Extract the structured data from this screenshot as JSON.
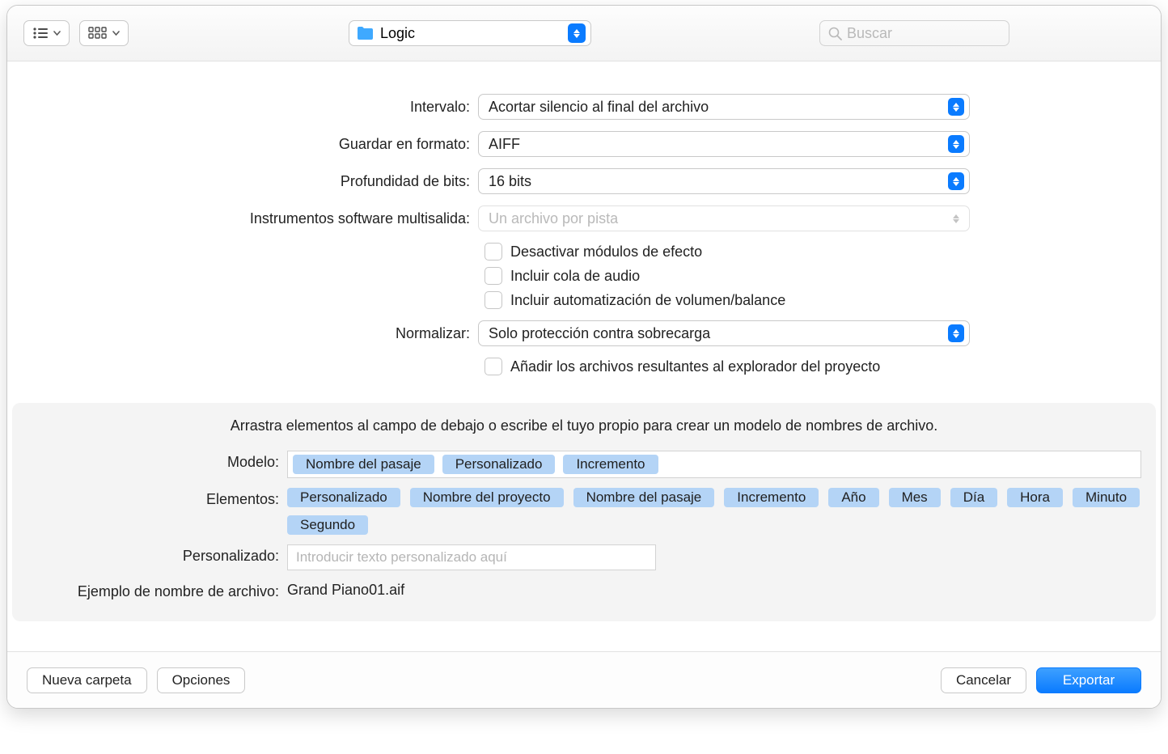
{
  "toolbar": {
    "location": "Logic",
    "search_placeholder": "Buscar"
  },
  "form": {
    "interval_label": "Intervalo:",
    "interval_value": "Acortar silencio al final del archivo",
    "format_label": "Guardar en formato:",
    "format_value": "AIFF",
    "bitdepth_label": "Profundidad de bits:",
    "bitdepth_value": "16 bits",
    "multioutput_label": "Instrumentos software multisalida:",
    "multioutput_value": "Un archivo por pista",
    "chk_bypass": "Desactivar módulos de efecto",
    "chk_tail": "Incluir cola de audio",
    "chk_vol": "Incluir automatización de volumen/balance",
    "normalize_label": "Normalizar:",
    "normalize_value": "Solo protección contra sobrecarga",
    "chk_add": "Añadir los archivos resultantes al explorador del proyecto"
  },
  "panel": {
    "instr": "Arrastra elementos al campo de debajo o escribe el tuyo propio para crear un modelo de nombres de archivo.",
    "model_label": "Modelo:",
    "model_tokens": [
      "Nombre del pasaje",
      "Personalizado",
      "Incremento"
    ],
    "elements_label": "Elementos:",
    "elements_tokens": [
      "Personalizado",
      "Nombre del proyecto",
      "Nombre del pasaje",
      "Incremento",
      "Año",
      "Mes",
      "Día",
      "Hora",
      "Minuto",
      "Segundo"
    ],
    "custom_label": "Personalizado:",
    "custom_placeholder": "Introducir texto personalizado aquí",
    "example_label": "Ejemplo de nombre de archivo:",
    "example_value": "Grand Piano01.aif"
  },
  "footer": {
    "new_folder": "Nueva carpeta",
    "options": "Opciones",
    "cancel": "Cancelar",
    "export": "Exportar"
  }
}
